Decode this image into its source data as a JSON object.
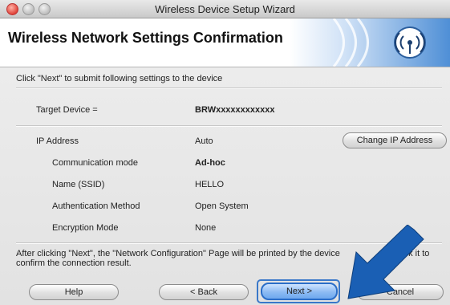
{
  "window": {
    "title": "Wireless Device Setup Wizard"
  },
  "header": {
    "title": "Wireless Network Settings Confirmation"
  },
  "instruction": "Click \"Next\" to submit following settings to the device",
  "target": {
    "label": "Target Device =",
    "value": "BRWxxxxxxxxxxxx"
  },
  "settings": {
    "ip": {
      "label": "IP Address",
      "value": "Auto"
    },
    "comm": {
      "label": "Communication mode",
      "value": "Ad-hoc"
    },
    "ssid": {
      "label": "Name (SSID)",
      "value": "HELLO"
    },
    "auth": {
      "label": "Authentication Method",
      "value": "Open System"
    },
    "enc": {
      "label": "Encryption Mode",
      "value": "None"
    }
  },
  "change_ip_label": "Change IP Address",
  "note_line1": "After clicking \"Next\", the \"Network Configuration\" Page will be printed by the device",
  "note_line1_end": "check it to",
  "note_line2": "confirm the connection result.",
  "buttons": {
    "help": "Help",
    "back": "< Back",
    "next": "Next >",
    "cancel": "Cancel"
  },
  "colors": {
    "accent": "#2b6ec8",
    "arrow": "#1a5fb4"
  },
  "icons": {
    "header_art": "wireless-signal-icon",
    "overlay": "pointer-arrow-icon"
  }
}
